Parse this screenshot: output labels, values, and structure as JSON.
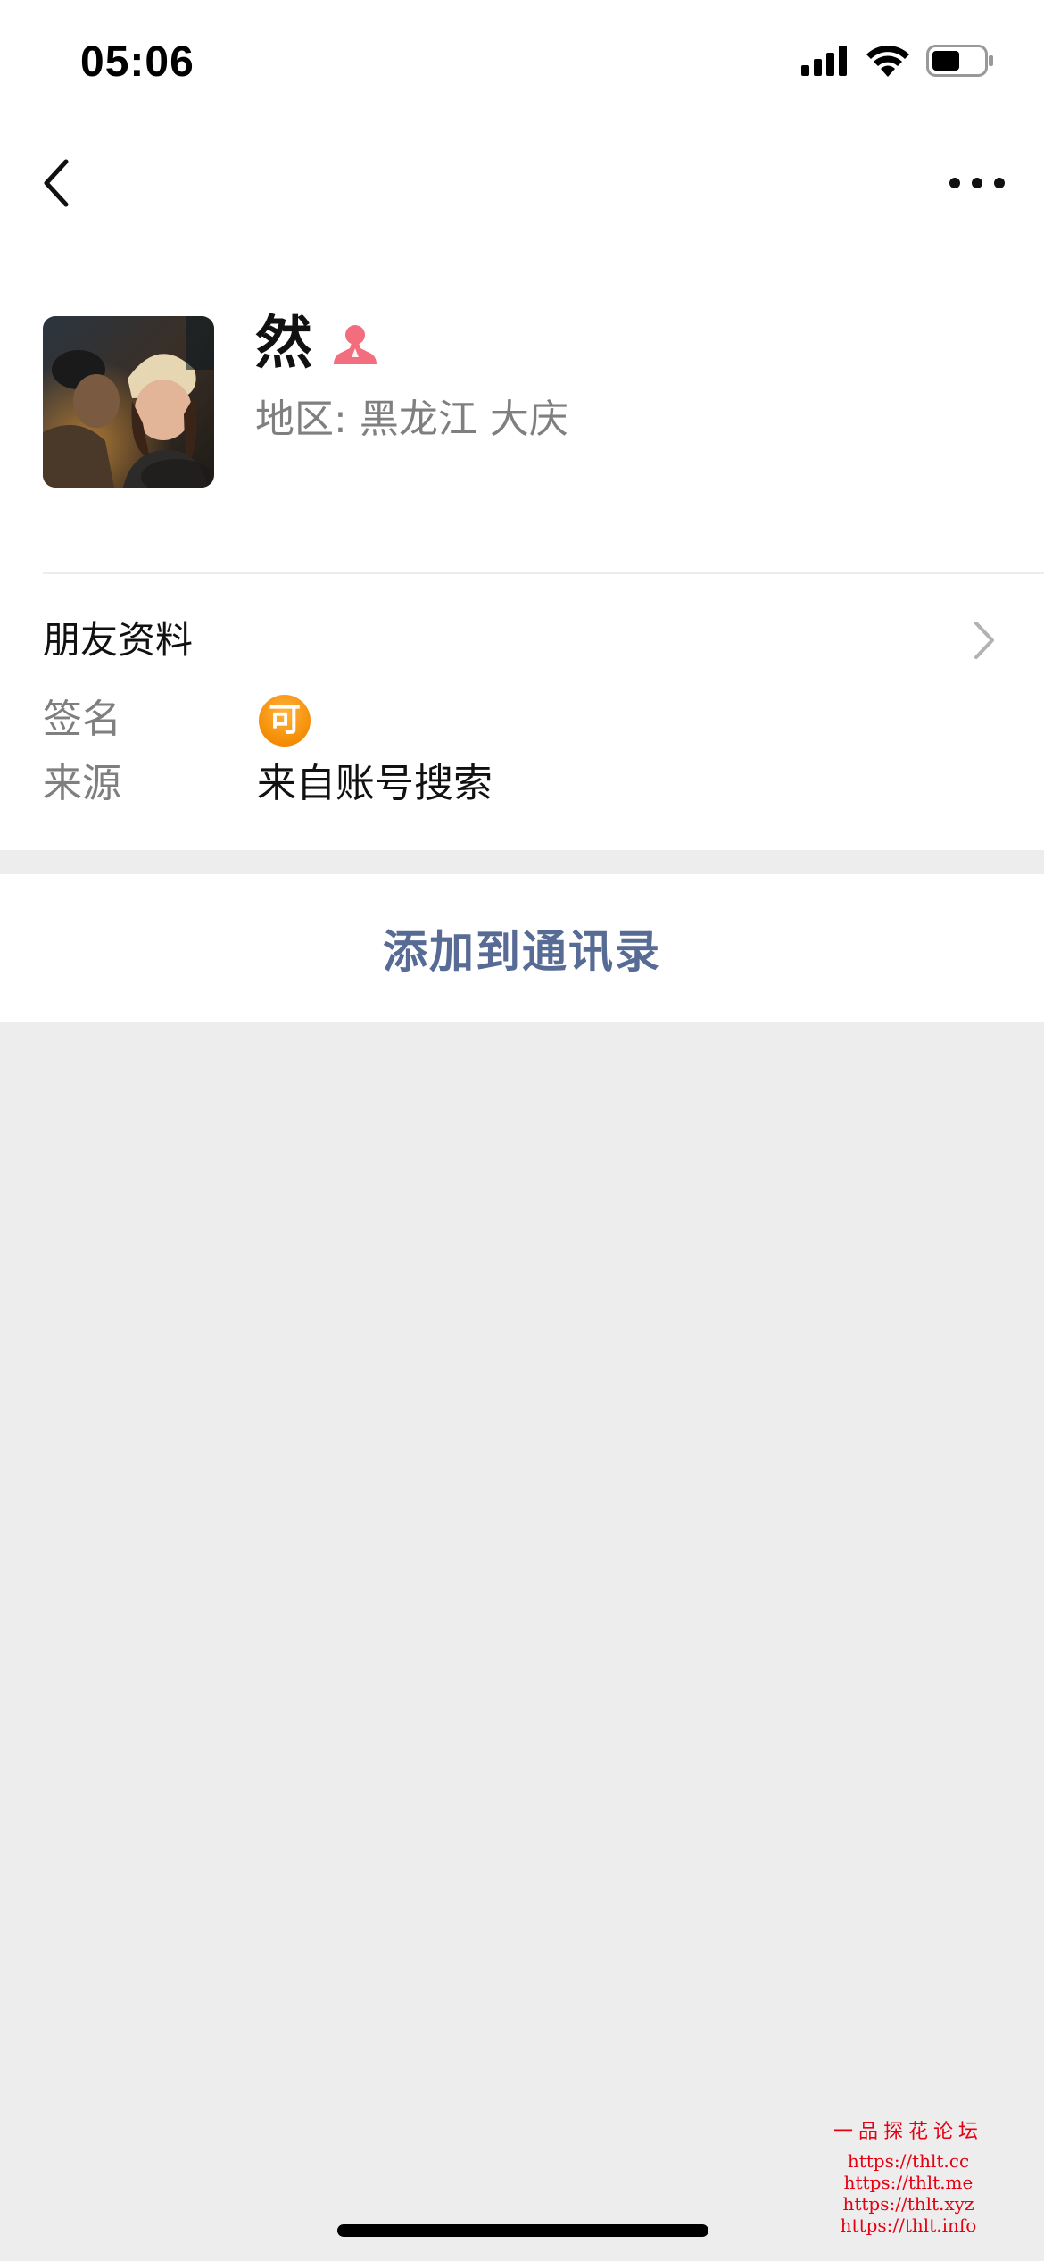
{
  "status_bar": {
    "time": "05:06"
  },
  "nav": {
    "back_icon": "chevron-left-icon",
    "more_icon": "more-dots-icon"
  },
  "profile": {
    "name": "然",
    "gender_icon": "female-icon",
    "gender_color": "#f26d7d",
    "region_label": "地区:",
    "region_value": "黑龙江 大庆"
  },
  "friend_info": {
    "section_title": "朋友资料",
    "signature_label": "签名",
    "signature_value": "可",
    "source_label": "来源",
    "source_value": "来自账号搜索"
  },
  "actions": {
    "add_to_contacts": "添加到通讯录",
    "accent_color": "#576b95"
  },
  "watermark": {
    "title": "一品探花论坛",
    "urls": [
      "https://thlt.cc",
      "https://thlt.me",
      "https://thlt.xyz",
      "https://thlt.info"
    ]
  }
}
